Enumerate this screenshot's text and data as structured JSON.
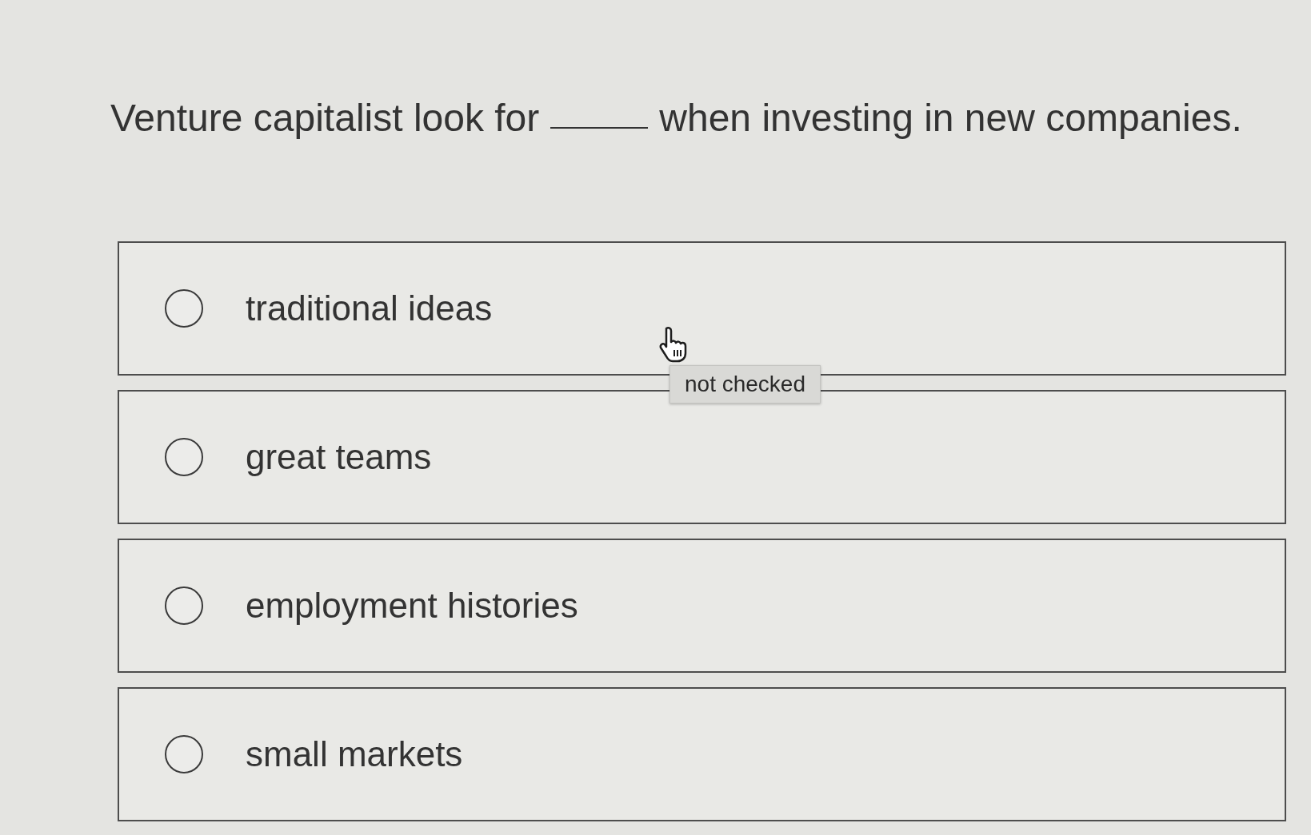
{
  "question": {
    "before": "Venture capitalist look for",
    "after": "when investing in new companies."
  },
  "options": [
    {
      "label": "traditional ideas",
      "selected": false,
      "hovered": true
    },
    {
      "label": "great teams",
      "selected": false,
      "hovered": false
    },
    {
      "label": "employment histories",
      "selected": false,
      "hovered": false
    },
    {
      "label": "small markets",
      "selected": false,
      "hovered": false
    }
  ],
  "tooltip": {
    "text": "not checked"
  }
}
